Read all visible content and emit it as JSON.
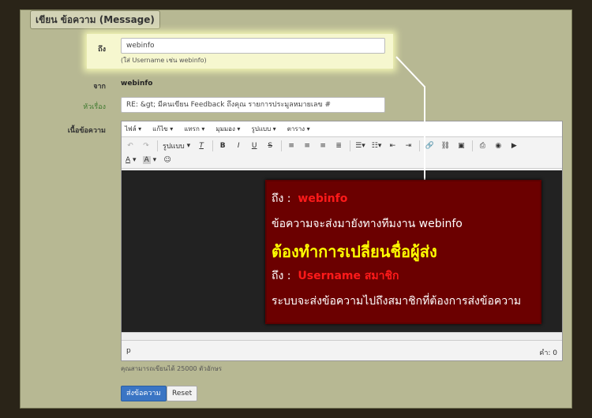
{
  "panel": {
    "title": "เขียน ข้อความ (Message)"
  },
  "form": {
    "to_label": "ถึง",
    "to_value": "webinfo",
    "to_hint": "(ใส่ Username เช่น webinfo)",
    "from_label": "จาก",
    "from_value": "webinfo",
    "subject_label": "หัวเรื่อง",
    "subject_value": "RE: &gt; มีคนเขียน Feedback ถึงคุณ รายการประมูลหมายเลข #",
    "body_label": "เนื้อข้อความ"
  },
  "editor": {
    "menus": [
      "ไฟล์",
      "แก้ไข",
      "แทรก",
      "มุมมอง",
      "รูปแบบ",
      "ตาราง"
    ],
    "format_label": "รูปแบบ",
    "status_path": "p",
    "word_count": "คำ: 0"
  },
  "note": {
    "line1_prefix": "ถึง :",
    "line1_value": "webinfo",
    "line2": "ข้อความจะส่งมายังทางทีมงาน webinfo",
    "line3": "ต้องทำการเปลี่ยนชื่อผู้ส่ง",
    "line4_prefix": "ถึง :",
    "line4_value": "Username สมาชิก",
    "line5": "ระบบจะส่งข้อความไปถึงสมาชิกที่ต้องการส่งข้อความ"
  },
  "footer": {
    "char_limit": "คุณสามารถเขียนได้ 25000 ตัวอักษร",
    "send_label": "ส่งข้อความ",
    "reset_label": "Reset"
  }
}
